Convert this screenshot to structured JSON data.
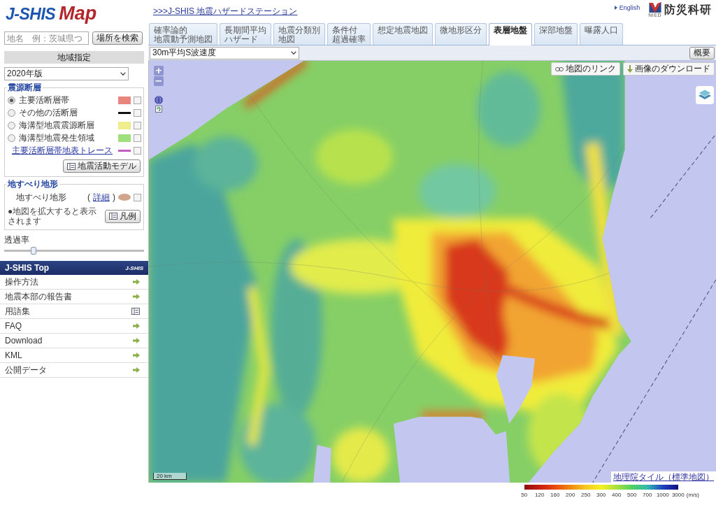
{
  "header": {
    "logo": [
      "J-SHIS",
      "Map"
    ],
    "station_link": ">>>J-SHIS 地震ハザードステーション",
    "language_link": "English",
    "org_caption": "NIED",
    "org_name": "防災科研"
  },
  "search": {
    "placeholder": "地名　例：茨城県つ",
    "button": "場所を検索"
  },
  "sidebar": {
    "region_heading": "地域指定",
    "version": "2020年版",
    "faults": {
      "title": "震源断層",
      "options": [
        {
          "label": "主要活断層帯",
          "selected": true,
          "kind": "fill",
          "color": "#e8857c",
          "checked": false
        },
        {
          "label": "その他の活断層",
          "selected": false,
          "kind": "line",
          "color": "#111111",
          "checked": false
        },
        {
          "label": "海溝型地震震源断層",
          "selected": false,
          "kind": "fill",
          "color": "#f0ee8c",
          "checked": false
        },
        {
          "label": "海溝型地震発生領域",
          "selected": false,
          "kind": "fill",
          "color": "#9ee07c",
          "checked": false
        }
      ],
      "trace": {
        "label": "主要活断層帯地表トレース",
        "color": "#c45cc4",
        "checked": false
      },
      "model_button": "地震活動モデル"
    },
    "landslide": {
      "title": "地すべり地形",
      "label": "地すべり地形",
      "detail_open": "(",
      "detail_link": "詳細",
      "detail_close": ")",
      "checked": false,
      "note": "●地図を拡大すると表示されます",
      "legend_button": "凡例"
    },
    "transparency": {
      "label": "透過率",
      "level": 0.2
    },
    "nav": {
      "title": "J-SHIS Top",
      "logo": "J-SHIS",
      "items": [
        {
          "label": "操作方法",
          "kind": "arrow"
        },
        {
          "label": "地震本部の報告書",
          "kind": "arrow"
        },
        {
          "label": "用語集",
          "kind": "glossary"
        },
        {
          "label": "FAQ",
          "kind": "arrow"
        },
        {
          "label": "Download",
          "kind": "arrow"
        },
        {
          "label": "KML",
          "kind": "arrow"
        },
        {
          "label": "公開データ",
          "kind": "arrow"
        }
      ]
    }
  },
  "tabs": [
    {
      "lines": [
        "確率論的",
        "地震動予測地図"
      ],
      "selected": false
    },
    {
      "lines": [
        "長期間平均",
        "ハザード"
      ],
      "selected": false
    },
    {
      "lines": [
        "地震分類別",
        "地図"
      ],
      "selected": false
    },
    {
      "lines": [
        "条件付",
        "超過確率"
      ],
      "selected": false
    },
    {
      "lines": [
        "想定地震地図"
      ],
      "selected": false
    },
    {
      "lines": [
        "微地形区分"
      ],
      "selected": false
    },
    {
      "lines": [
        "表層地盤"
      ],
      "selected": true
    },
    {
      "lines": [
        "深部地盤"
      ],
      "selected": false
    },
    {
      "lines": [
        "曝露人口"
      ],
      "selected": false
    }
  ],
  "map": {
    "layer": "30m平均S波速度",
    "summary_button": "概要",
    "zoom": [
      "+",
      "−"
    ],
    "link_button": "地図のリンク",
    "download_button": "画像のダウンロード",
    "scale": "20 km",
    "attribution": "地理院タイル（標準地図）"
  },
  "legend": {
    "ticks": [
      "50",
      "120",
      "160",
      "200",
      "250",
      "300",
      "400",
      "500",
      "700",
      "1000",
      "3000"
    ],
    "unit": "(m/s)"
  }
}
